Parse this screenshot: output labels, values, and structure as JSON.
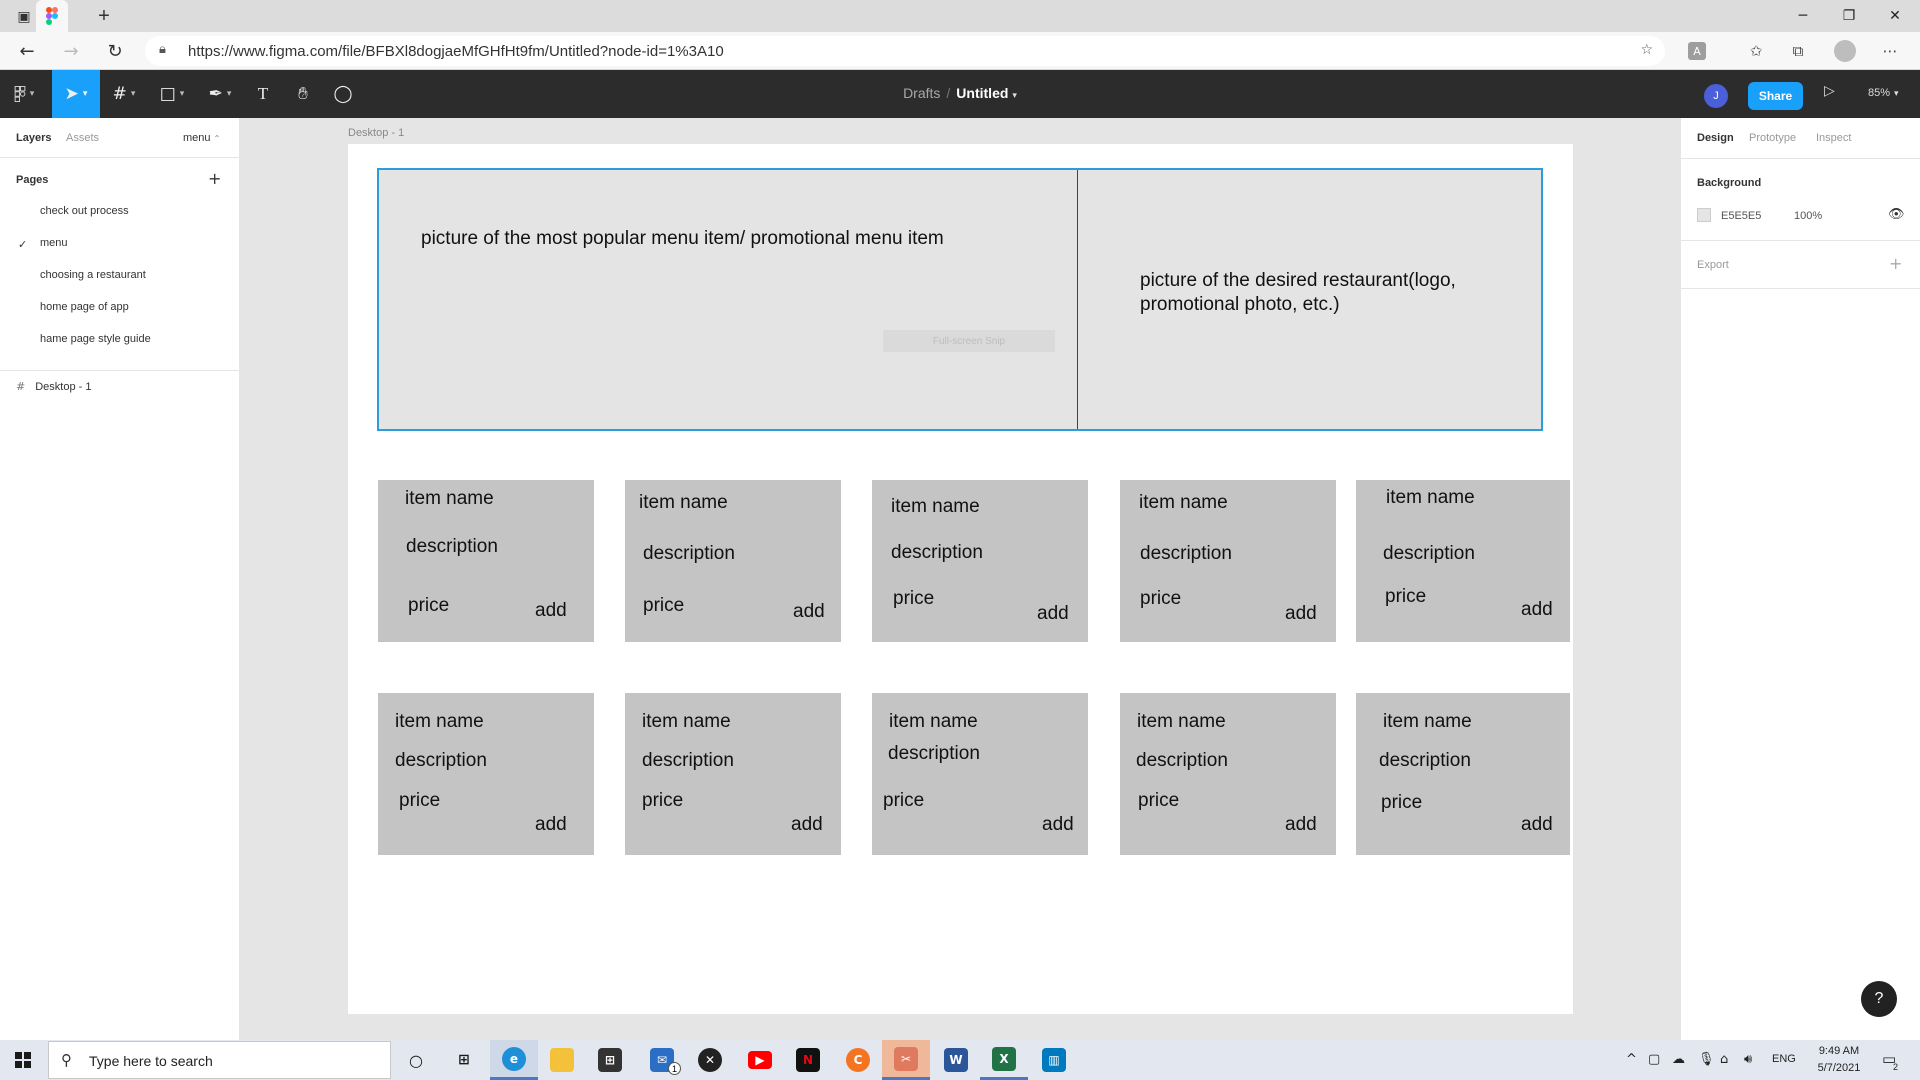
{
  "browser": {
    "url": "https://www.figma.com/file/BFBXl8dogjaeMfGHfHt9fm/Untitled?node-id=1%3A10"
  },
  "toolbar": {
    "breadcrumb_drafts": "Drafts",
    "breadcrumb_sep": "/",
    "file_name": "Untitled",
    "avatar_initial": "J",
    "share_label": "Share",
    "zoom": "85%"
  },
  "left_panel": {
    "tabs": [
      "Layers",
      "Assets"
    ],
    "current_page_selector": "menu",
    "pages_heading": "Pages",
    "pages": [
      {
        "label": "check out process",
        "selected": false
      },
      {
        "label": "menu",
        "selected": true
      },
      {
        "label": "choosing a restaurant",
        "selected": false
      },
      {
        "label": "home page of app",
        "selected": false
      },
      {
        "label": "hame page style guide",
        "selected": false
      }
    ],
    "layers": [
      {
        "label": "Desktop - 1"
      }
    ]
  },
  "canvas": {
    "frame_label": "Desktop - 1",
    "hero_left_text": "picture of the most popular menu item/ promotional menu item",
    "hero_right_text": "picture of the desired restaurant(logo, promotional photo, etc.)",
    "snip_overlay": "Full-screen Snip",
    "card_labels": {
      "name": "item name",
      "description": "description",
      "price": "price",
      "add": "add"
    },
    "card_count": 10
  },
  "right_panel": {
    "tabs": [
      "Design",
      "Prototype",
      "Inspect"
    ],
    "background_heading": "Background",
    "background_hex": "E5E5E5",
    "background_opacity": "100%",
    "export_heading": "Export"
  },
  "help_label": "?",
  "taskbar": {
    "search_placeholder": "Type here to search",
    "language": "ENG",
    "time": "9:49 AM",
    "date": "5/7/2021",
    "notification_count": "2",
    "mail_badge": "1"
  },
  "colors": {
    "figma_blue": "#18a0fb",
    "selection_blue": "#2d9cdb",
    "toolbar_bg": "#2c2c2c",
    "card_gray": "#c4c4c4",
    "canvas_bg": "#e5e5e5"
  }
}
